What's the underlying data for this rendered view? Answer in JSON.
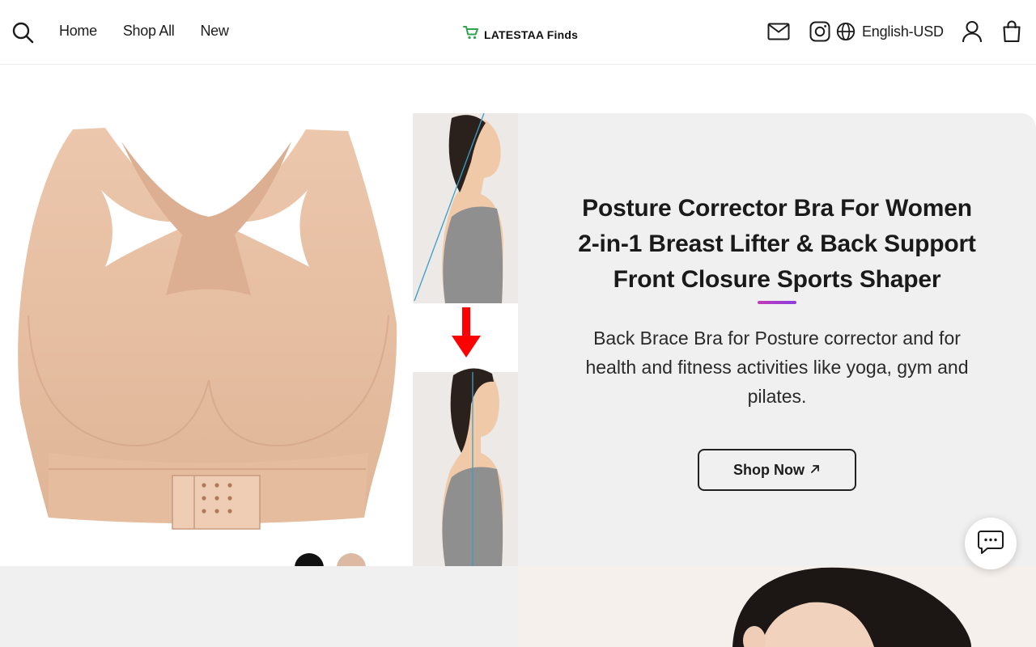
{
  "header": {
    "nav": [
      {
        "label": "Home"
      },
      {
        "label": "Shop All"
      },
      {
        "label": "New"
      }
    ],
    "brand": {
      "name": "LATESTAA Finds",
      "icon": "cart-icon"
    },
    "language": "English-USD",
    "icons": [
      "search-icon",
      "mail-icon",
      "instagram-icon",
      "globe-icon",
      "account-icon",
      "shopping-bag-icon"
    ]
  },
  "hero": {
    "title_lines": [
      "Posture Corrector Bra For Women",
      "2-in-1 Breast Lifter & Back Support",
      "Front Closure Sports Shaper"
    ],
    "description": "Back Brace Bra for Posture corrector and for health and fitness activities like yoga, gym and pilates.",
    "cta_label": "Shop Now",
    "cta_icon": "arrow-up-right-icon",
    "color_swatches": [
      {
        "name": "Black",
        "color": "#111111"
      },
      {
        "name": "Nude",
        "color": "#dcb9a3"
      }
    ]
  },
  "colors": {
    "accent_gradient_start": "#c33bb8",
    "accent_gradient_end": "#8a3ee0",
    "panel_bg": "#f0f0f0",
    "brand_cart": "#2ea44f"
  },
  "chat": {
    "icon": "chat-icon"
  }
}
